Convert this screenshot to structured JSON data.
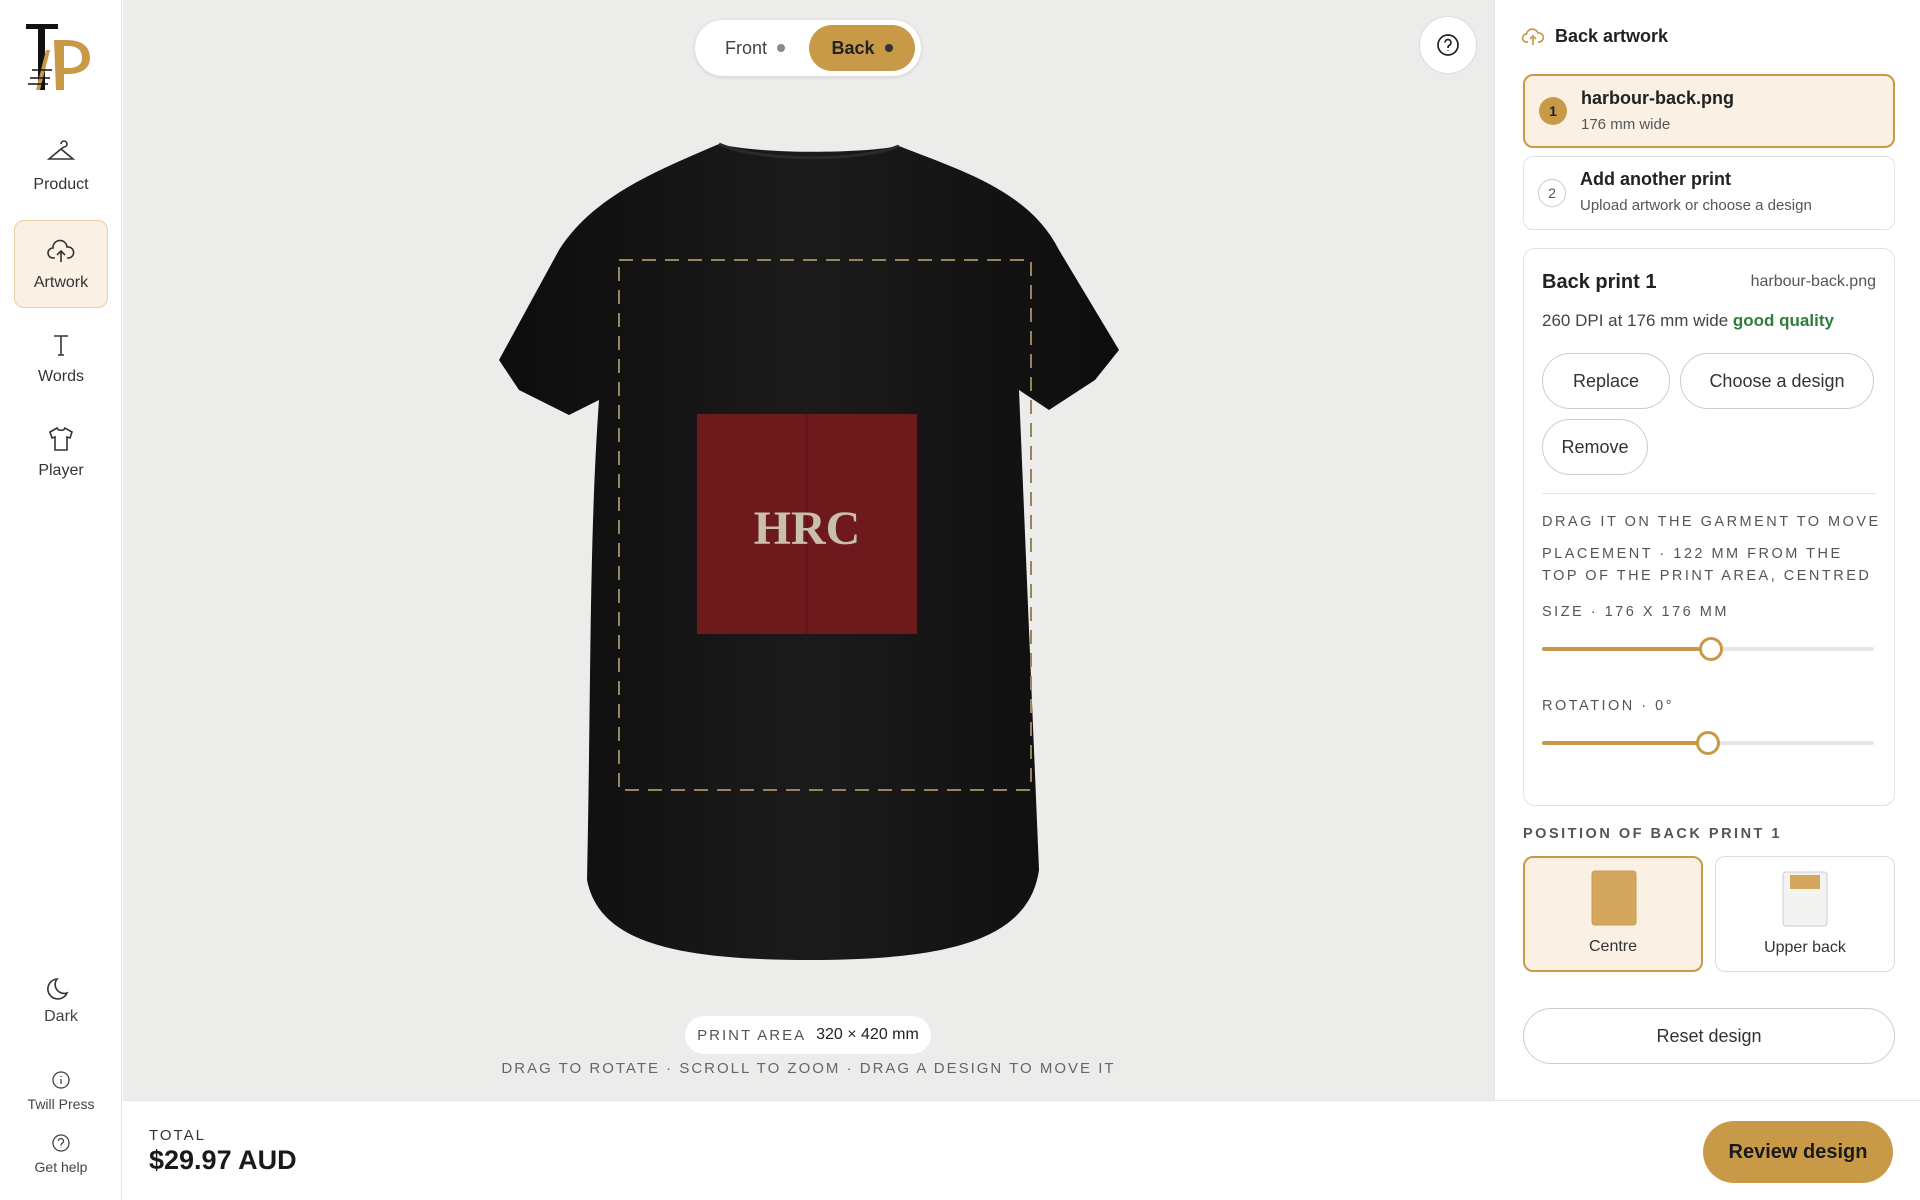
{
  "brand": {
    "logo_text": "TP",
    "accent": "#c89a48"
  },
  "sidebar": {
    "items": [
      {
        "label": "Product",
        "icon": "hanger-icon"
      },
      {
        "label": "Artwork",
        "icon": "cloud-upload-icon",
        "active": true
      },
      {
        "label": "Words",
        "icon": "text-icon"
      },
      {
        "label": "Player",
        "icon": "tshirt-icon"
      }
    ],
    "dark_label": "Dark",
    "about_label": "Twill Press",
    "help_label": "Get help"
  },
  "canvas": {
    "view_toggle": {
      "front": "Front",
      "back": "Back",
      "selected": "Back"
    },
    "print_text": "HRC",
    "print_area": {
      "label": "PRINT AREA",
      "value": "320 × 420 mm"
    },
    "hint": "DRAG TO ROTATE · SCROLL TO ZOOM · DRAG A DESIGN TO MOVE IT"
  },
  "panel": {
    "title": "Back artwork",
    "artworks": [
      {
        "num": "1",
        "title": "harbour-back.png",
        "subtitle": "176 mm wide",
        "selected": true
      },
      {
        "num": "2",
        "title": "Add another print",
        "subtitle": "Upload artwork or choose a design"
      }
    ],
    "print_card": {
      "title": "Back print 1",
      "file": "harbour-back.png",
      "dpi_text": "260 DPI at 176 mm wide",
      "quality": "good quality",
      "replace": "Replace",
      "choose": "Choose a design",
      "remove": "Remove",
      "drag_hint": "DRAG IT ON THE GARMENT TO MOVE",
      "placement": "PLACEMENT · 122 MM FROM THE TOP OF THE PRINT AREA, CENTRED",
      "size_label": "SIZE · 176 X 176 MM",
      "size_fraction": 0.51,
      "rotation_label": "ROTATION · 0°",
      "rotation_fraction": 0.5
    },
    "position": {
      "label": "POSITION OF BACK PRINT 1",
      "options": [
        {
          "label": "Centre",
          "selected": true
        },
        {
          "label": "Upper back"
        }
      ]
    },
    "reset": "Reset design"
  },
  "footer": {
    "total_label": "TOTAL",
    "total_value": "$29.97 AUD",
    "review": "Review design"
  }
}
